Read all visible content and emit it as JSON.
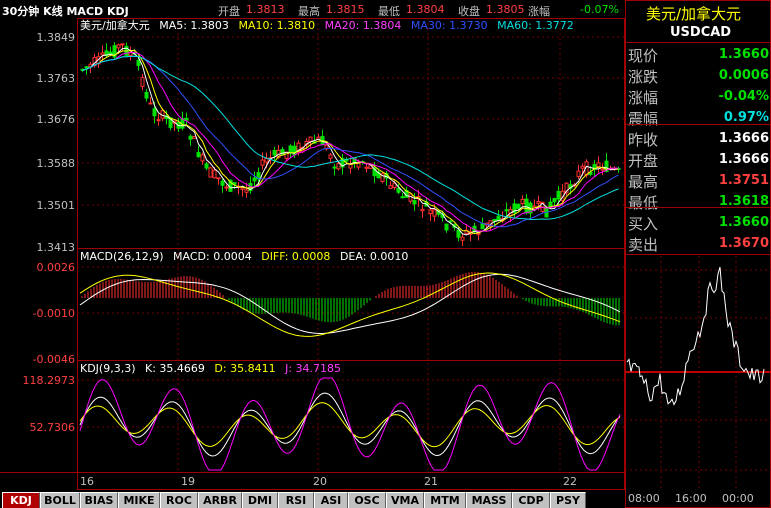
{
  "topbar": {
    "title": "30分钟 K线 MACD KDJ",
    "open_label": "开盘",
    "open_value": "1.3813",
    "high_label": "最高",
    "high_value": "1.3815",
    "low_label": "最低",
    "low_value": "1.3804",
    "close_label": "收盘",
    "close_value": "1.3805",
    "change_label": "涨幅",
    "change_value": "-0.07%"
  },
  "main_chart": {
    "name": "美元/加拿大元",
    "ma5": "MA5: 1.3803",
    "ma10": "MA10: 1.3810",
    "ma20": "MA20: 1.3804",
    "ma30": "MA30: 1.3730",
    "ma60": "MA60: 1.3772",
    "y_labels": [
      "1.3849",
      "1.3763",
      "1.3676",
      "1.3588",
      "1.3501",
      "1.3413"
    ]
  },
  "macd": {
    "header": "MACD(26,12,9)",
    "macd": "MACD: 0.0004",
    "diff": "DIFF: 0.0008",
    "dea": "DEA: 0.0010",
    "y_labels": [
      "0.0026",
      "-0.0010",
      "-0.0046"
    ]
  },
  "kdj": {
    "header": "KDJ(9,3,3)",
    "k": "K: 35.4669",
    "d": "D: 35.8411",
    "j": "J: 34.7185",
    "y_labels": [
      "118.2973",
      "52.7306"
    ]
  },
  "x_labels": [
    "16",
    "19",
    "20",
    "21",
    "22"
  ],
  "tabs": [
    "KDJ",
    "BOLL",
    "BIAS",
    "MIKE",
    "ROC",
    "ARBR",
    "DMI",
    "RSI",
    "ASI",
    "OSC",
    "VMA",
    "MTM",
    "MASS",
    "CDP",
    "PSY"
  ],
  "active_tab": "KDJ",
  "panel": {
    "title": "美元/加拿大元",
    "code": "USDCAD",
    "rows": [
      {
        "label": "现价",
        "value": "1.3660",
        "color": "#00e000"
      },
      {
        "label": "涨跌",
        "value": "0.0006",
        "color": "#00e000"
      },
      {
        "label": "涨幅",
        "value": "-0.04%",
        "color": "#00e000"
      },
      {
        "label": "震幅",
        "value": "0.97%",
        "color": "#00e0e0"
      },
      {
        "label": "昨收",
        "value": "1.3666",
        "color": "#ffffff"
      },
      {
        "label": "开盘",
        "value": "1.3666",
        "color": "#ffffff"
      },
      {
        "label": "最高",
        "value": "1.3751",
        "color": "#ff4040"
      },
      {
        "label": "最低",
        "value": "1.3618",
        "color": "#00e000"
      },
      {
        "label": "买入",
        "value": "1.3660",
        "color": "#00e000"
      },
      {
        "label": "卖出",
        "value": "1.3670",
        "color": "#ff4040"
      }
    ],
    "mini_times": [
      "08:00",
      "16:00",
      "00:00"
    ]
  },
  "colors": {
    "up": "#ff3030",
    "down": "#00e000",
    "ma5": "#ffffff",
    "ma10": "#ffff00",
    "ma20": "#ff00ff",
    "ma30": "#3050ff",
    "ma60": "#00e0e0"
  }
}
